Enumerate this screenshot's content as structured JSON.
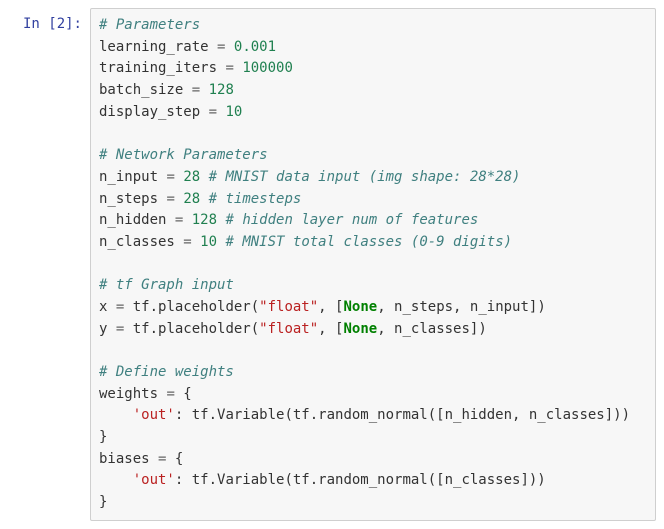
{
  "cell": {
    "prompt": "In  [2]:",
    "code": {
      "l01_c": "# Parameters",
      "l02_a": "learning_rate ",
      "l02_eq": "=",
      "l02_b": " ",
      "l02_v": "0.001",
      "l03_a": "training_iters ",
      "l03_eq": "=",
      "l03_b": " ",
      "l03_v": "100000",
      "l04_a": "batch_size ",
      "l04_eq": "=",
      "l04_b": " ",
      "l04_v": "128",
      "l05_a": "display_step ",
      "l05_eq": "=",
      "l05_b": " ",
      "l05_v": "10",
      "l07_c": "# Network Parameters",
      "l08_a": "n_input ",
      "l08_eq": "=",
      "l08_b": " ",
      "l08_v": "28",
      "l08_sp": " ",
      "l08_c": "# MNIST data input (img shape: 28*28)",
      "l09_a": "n_steps ",
      "l09_eq": "=",
      "l09_b": " ",
      "l09_v": "28",
      "l09_sp": " ",
      "l09_c": "# timesteps",
      "l10_a": "n_hidden ",
      "l10_eq": "=",
      "l10_b": " ",
      "l10_v": "128",
      "l10_sp": " ",
      "l10_c": "# hidden layer num of features",
      "l11_a": "n_classes ",
      "l11_eq": "=",
      "l11_b": " ",
      "l11_v": "10",
      "l11_sp": " ",
      "l11_c": "# MNIST total classes (0-9 digits)",
      "l13_c": "# tf Graph input",
      "l14_a": "x ",
      "l14_eq": "=",
      "l14_b": " tf.placeholder(",
      "l14_s": "\"float\"",
      "l14_c": ", [",
      "l14_none": "None",
      "l14_d": ", n_steps, n_input])",
      "l15_a": "y ",
      "l15_eq": "=",
      "l15_b": " tf.placeholder(",
      "l15_s": "\"float\"",
      "l15_c": ", [",
      "l15_none": "None",
      "l15_d": ", n_classes])",
      "l17_c": "# Define weights",
      "l18_a": "weights ",
      "l18_eq": "=",
      "l18_b": " {",
      "l19_ind": "    ",
      "l19_s": "'out'",
      "l19_b": ": tf.Variable(tf.random_normal([n_hidden, n_classes]))",
      "l20_a": "}",
      "l21_a": "biases ",
      "l21_eq": "=",
      "l21_b": " {",
      "l22_ind": "    ",
      "l22_s": "'out'",
      "l22_b": ": tf.Variable(tf.random_normal([n_classes]))",
      "l23_a": "}"
    }
  }
}
